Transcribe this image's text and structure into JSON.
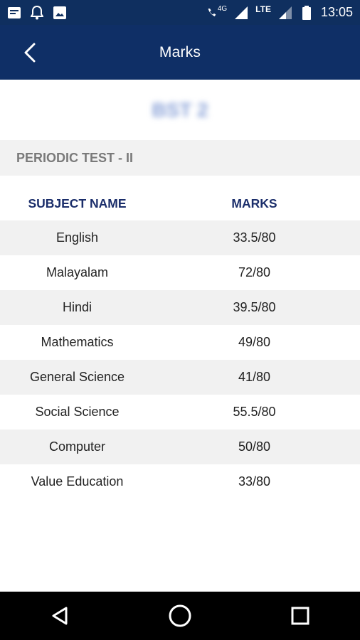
{
  "status_bar": {
    "time": "13:05",
    "network_label": "LTE",
    "call_label": "4G"
  },
  "app_bar": {
    "title": "Marks"
  },
  "student": {
    "name": "BST 2"
  },
  "exam": {
    "title": "PERIODIC TEST - II"
  },
  "table": {
    "headers": {
      "subject": "SUBJECT NAME",
      "marks": "MARKS"
    },
    "rows": [
      {
        "subject": "English",
        "marks": "33.5/80"
      },
      {
        "subject": "Malayalam",
        "marks": "72/80"
      },
      {
        "subject": "Hindi",
        "marks": "39.5/80"
      },
      {
        "subject": "Mathematics",
        "marks": "49/80"
      },
      {
        "subject": "General Science",
        "marks": "41/80"
      },
      {
        "subject": "Social Science",
        "marks": "55.5/80"
      },
      {
        "subject": "Computer",
        "marks": "50/80"
      },
      {
        "subject": "Value Education",
        "marks": "33/80"
      }
    ]
  },
  "colors": {
    "app_bar": "#0f2f66",
    "header_text": "#1a2d6a",
    "section_bg": "#f2f2f2"
  }
}
